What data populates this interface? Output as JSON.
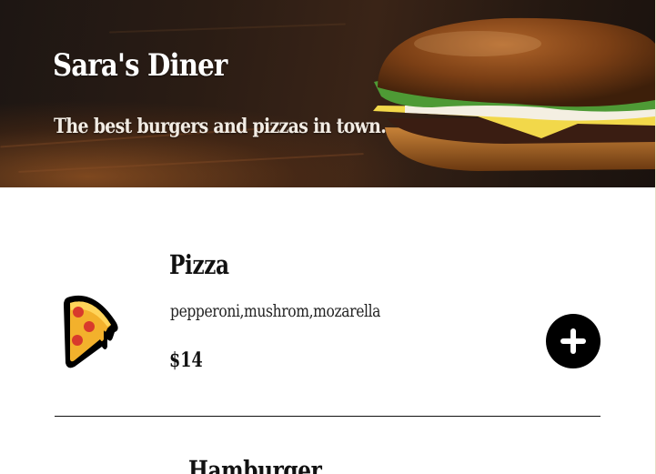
{
  "header": {
    "title": "Sara's Diner",
    "subtitle": "The best burgers and pizzas in town."
  },
  "menu": {
    "items": [
      {
        "name": "Pizza",
        "ingredients": "pepperoni,mushrom,mozarella",
        "price": "$14",
        "icon": "pizza-slice-icon",
        "add_icon": "plus-icon"
      },
      {
        "name": "Hamburger",
        "icon": "hamburger-icon"
      }
    ]
  },
  "colors": {
    "text": "#111111",
    "button": "#000000",
    "button_icon": "#ffffff",
    "pizza_crust": "#f3b12c",
    "pepperoni": "#d83a2c"
  }
}
